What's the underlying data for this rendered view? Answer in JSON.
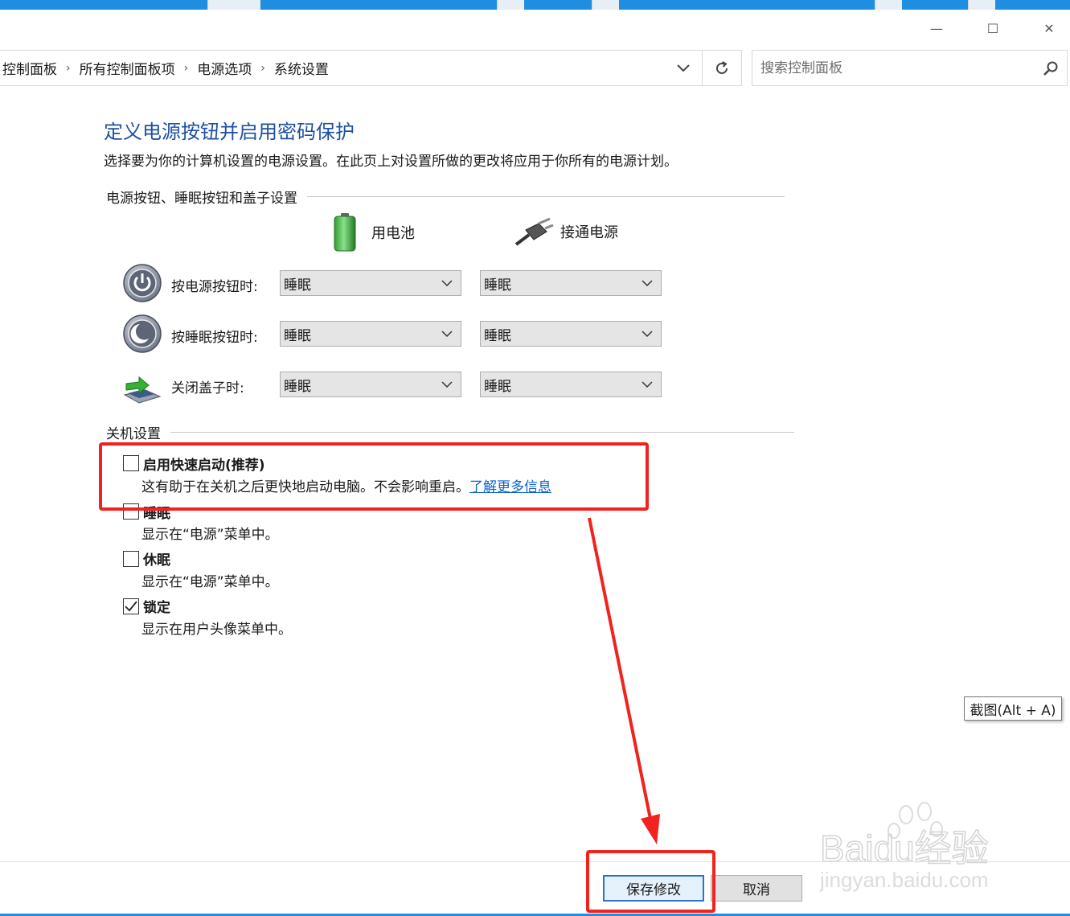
{
  "window": {
    "minimize_symbol": "—",
    "maximize_symbol": "☐",
    "close_symbol": "✕"
  },
  "breadcrumb": {
    "items": [
      "控制面板",
      "所有控制面板项",
      "电源选项",
      "系统设置"
    ],
    "separator": "›"
  },
  "search": {
    "placeholder": "搜索控制面板"
  },
  "page": {
    "title": "定义电源按钮并启用密码保护",
    "description": "选择要为你的计算机设置的电源设置。在此页上对设置所做的更改将应用于你所有的电源计划。"
  },
  "power_buttons_section": {
    "heading": "电源按钮、睡眠按钮和盖子设置",
    "columns": {
      "battery": "用电池",
      "plugged_in": "接通电源"
    },
    "rows": [
      {
        "label": "按电源按钮时:",
        "battery": "睡眠",
        "plugged_in": "睡眠",
        "icon": "power-button-icon"
      },
      {
        "label": "按睡眠按钮时:",
        "battery": "睡眠",
        "plugged_in": "睡眠",
        "icon": "sleep-button-icon"
      },
      {
        "label": "关闭盖子时:",
        "battery": "睡眠",
        "plugged_in": "睡眠",
        "icon": "laptop-lid-icon"
      }
    ]
  },
  "shutdown_section": {
    "heading": "关机设置",
    "options": [
      {
        "label": "启用快速启动(推荐)",
        "desc": "这有助于在关机之后更快地启动电脑。不会影响重启。",
        "link": "了解更多信息",
        "checked": false
      },
      {
        "label": "睡眠",
        "desc": "显示在“电源”菜单中。",
        "checked": false
      },
      {
        "label": "休眠",
        "desc": "显示在“电源”菜单中。",
        "checked": false
      },
      {
        "label": "锁定",
        "desc": "显示在用户头像菜单中。",
        "checked": true
      }
    ]
  },
  "tooltip": {
    "text": "截图(Alt + A)"
  },
  "footer": {
    "save_label": "保存修改",
    "cancel_label": "取消"
  },
  "watermark": {
    "brand": "Baidu经验",
    "url": "jingyan.baidu.com"
  },
  "colors": {
    "title_blue": "#1e50a2",
    "link_blue": "#0b62c9",
    "annotation_red": "#f0231e",
    "taskbar_blue": "#1e8fe0"
  }
}
